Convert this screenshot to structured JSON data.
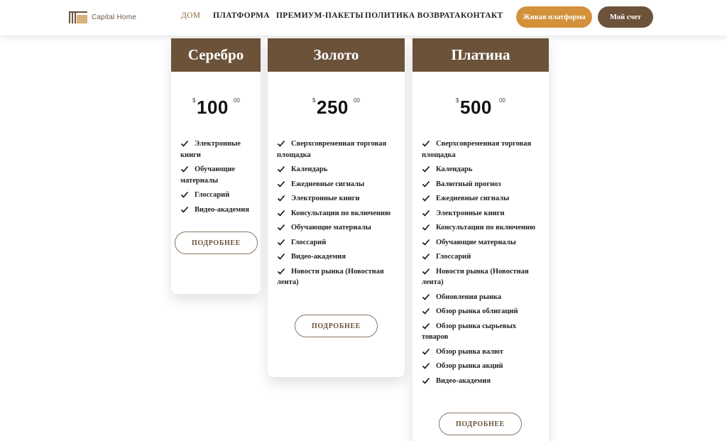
{
  "header": {
    "logo_text": "Capital Home",
    "nav": [
      {
        "label": "ДОМ",
        "active": true
      },
      {
        "label": "ПЛАТФОРМА",
        "active": false
      },
      {
        "label": "ПРЕМИУМ-ПАКЕТЫ",
        "active": false
      },
      {
        "label": "ПОЛИТИКА ВОЗВРАТА",
        "active": false
      },
      {
        "label": "КОНТАКТ",
        "active": false
      }
    ],
    "live_platform_label": "Живая платформа",
    "account_label": "Мой счет"
  },
  "plans": [
    {
      "name": "Серебро",
      "currency": "$",
      "amount": "100",
      "cents": "00",
      "features": [
        "Электронные книги",
        "Обучающие материалы",
        "Глоссарий",
        "Видео-академия"
      ],
      "button_label": "ПОДРОБНЕЕ"
    },
    {
      "name": "Золото",
      "currency": "$",
      "amount": "250",
      "cents": "00",
      "features": [
        "Сверхсовременная торговая площадка",
        "Календарь",
        "Ежедневные сигналы",
        "Электронные книги",
        "Консультации по включению",
        "Обучающие материалы",
        "Глоссарий",
        "Видео-академия",
        "Новости рынка (Новостная лента)"
      ],
      "button_label": "ПОДРОБНЕЕ"
    },
    {
      "name": "Платина",
      "currency": "$",
      "amount": "500",
      "cents": "00",
      "features": [
        "Сверхсовременная торговая площадка",
        "Календарь",
        "Валютный прогноз",
        "Ежедневные сигналы",
        "Электронные книги",
        "Консультации по включению",
        "Обучающие материалы",
        "Глоссарий",
        "Новости рынка (Новостная лента)",
        "Обновления рынка",
        "Обзор рынка облигаций",
        "Обзор рынка сырьевых товаров",
        "Обзор рынка валют",
        "Обзор рынка акций",
        "Видео-академия"
      ],
      "button_label": "ПОДРОБНЕЕ"
    }
  ],
  "colors": {
    "brand_brown": "#6b5239",
    "accent_orange": "#d3913b",
    "logo_gold": "#d8b27a"
  },
  "icons": {
    "feature_bullet": "check-icon"
  }
}
